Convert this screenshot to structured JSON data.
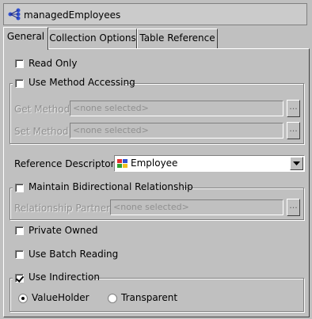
{
  "window": {
    "title": "managedEmployees",
    "icon": "mapping-tree-icon"
  },
  "tabs": [
    {
      "label": "General",
      "active": true
    },
    {
      "label": "Collection Options",
      "active": false
    },
    {
      "label": "Table Reference",
      "active": false
    }
  ],
  "general": {
    "read_only": {
      "label": "Read Only",
      "checked": false
    },
    "method_accessing": {
      "label": "Use Method Accessing",
      "checked": false,
      "get_method": {
        "label": "Get Method:",
        "value": "<none selected>",
        "button": "..."
      },
      "set_method": {
        "label": "Set Method:",
        "value": "<none selected>",
        "button": "..."
      }
    },
    "reference_descriptor": {
      "label": "Reference Descriptor:",
      "value": "Employee",
      "icon": "descriptor-icon"
    },
    "bidirectional": {
      "label": "Maintain Bidirectional Relationship",
      "checked": false,
      "partner": {
        "label": "Relationship Partner:",
        "value": "<none selected>",
        "button": "..."
      }
    },
    "private_owned": {
      "label": "Private Owned",
      "checked": false
    },
    "batch_reading": {
      "label": "Use Batch Reading",
      "checked": false
    },
    "indirection": {
      "label": "Use Indirection",
      "checked": true,
      "options": [
        {
          "label": "ValueHolder",
          "selected": true
        },
        {
          "label": "Transparent",
          "selected": false
        }
      ]
    }
  }
}
